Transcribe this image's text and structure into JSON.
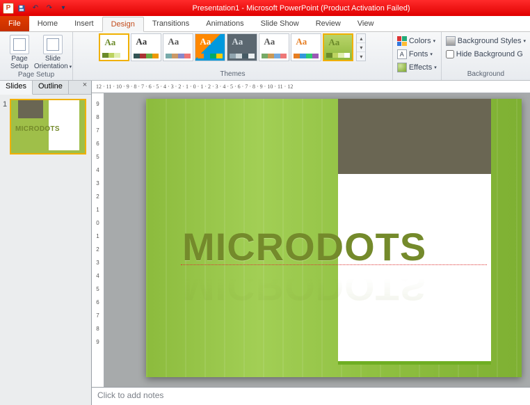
{
  "title": "Presentation1 - Microsoft PowerPoint (Product Activation Failed)",
  "tabs": {
    "file": "File",
    "home": "Home",
    "insert": "Insert",
    "design": "Design",
    "transitions": "Transitions",
    "animations": "Animations",
    "slideshow": "Slide Show",
    "review": "Review",
    "view": "View"
  },
  "ribbon": {
    "page_setup": {
      "label": "Page\nSetup",
      "group": "Page Setup"
    },
    "orientation": {
      "label": "Slide\nOrientation"
    },
    "themes_group": "Themes",
    "colors": "Colors",
    "fonts": "Fonts",
    "effects": "Effects",
    "bg_styles": "Background Styles",
    "hide_bg": "Hide Background G",
    "bg_group": "Background"
  },
  "left": {
    "slides_tab": "Slides",
    "outline_tab": "Outline",
    "slide_num": "1"
  },
  "ruler": "12 · 11 · 10 · 9 · 8 · 7 · 6 · 5 · 4 · 3 · 2 · 1 · 0 · 1 · 2 · 3 · 4 · 5 · 6 · 7 · 8 · 9 · 10 · 11 · 12",
  "slide": {
    "title": "MICRODOTS",
    "thumb_title": "MICRODOTS"
  },
  "notes_placeholder": "Click to add notes",
  "theme_samples": [
    "Aa",
    "Aa",
    "Aa",
    "Aa",
    "Aa",
    "Aa",
    "Aa",
    "Aa"
  ]
}
